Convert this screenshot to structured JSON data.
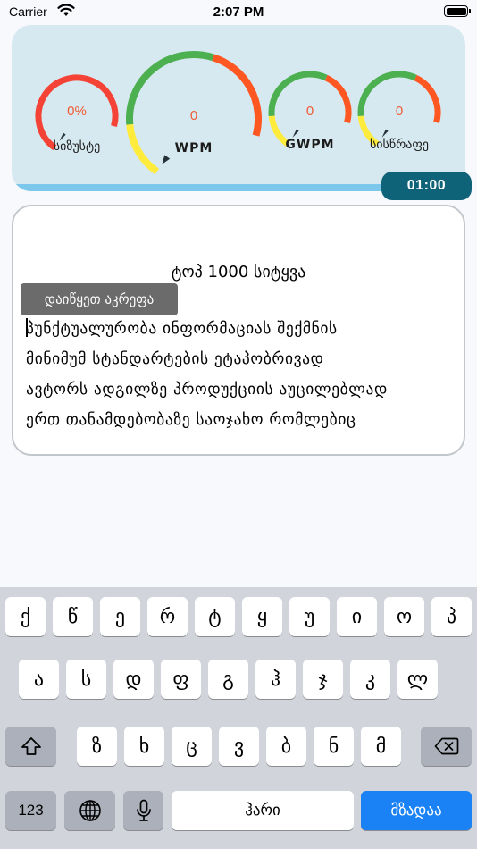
{
  "status_bar": {
    "carrier": "Carrier",
    "time": "2:07 PM"
  },
  "gauges": [
    {
      "id": "accuracy",
      "value": "0%",
      "label": "სიზუსტე"
    },
    {
      "id": "wpm",
      "value": "0",
      "label": "WPM"
    },
    {
      "id": "gwpm",
      "value": "0",
      "label": "GWPM"
    },
    {
      "id": "speed",
      "value": "0",
      "label": "სისწრაფე"
    }
  ],
  "gauge_colors": {
    "red": "#f44336",
    "orange": "#ff5722",
    "green": "#4caf50",
    "yellow": "#ffeb3b",
    "needle": "#263238"
  },
  "progress": {
    "fraction": 0.97
  },
  "timer": "01:00",
  "test": {
    "title": "ტოპ 1000 სიტყვა",
    "tooltip": "დაიწყეთ აკრეფა",
    "lines": [
      "პუნქტუალურობა ინფორმაციას შექმნის",
      "მინიმუმ სტანდარტების ეტაპობრივად",
      "ავტორს ადგილზე პროდუქციის აუცილებლად",
      "ერთ თანამდებობაზე საოჯახო რომლებიც"
    ]
  },
  "keyboard": {
    "row1": [
      "ქ",
      "წ",
      "ე",
      "რ",
      "ტ",
      "ყ",
      "უ",
      "ი",
      "ო",
      "პ"
    ],
    "row2": [
      "ა",
      "ს",
      "დ",
      "ფ",
      "გ",
      "ჰ",
      "ჯ",
      "კ",
      "ლ"
    ],
    "row3": [
      "ზ",
      "ხ",
      "ც",
      "ვ",
      "ბ",
      "ნ",
      "მ"
    ],
    "numbers_label": "123",
    "space_label": "ჰარი",
    "return_label": "მზადაა",
    "icons": [
      "shift-icon",
      "backspace-icon",
      "globe-icon",
      "microphone-icon"
    ]
  }
}
